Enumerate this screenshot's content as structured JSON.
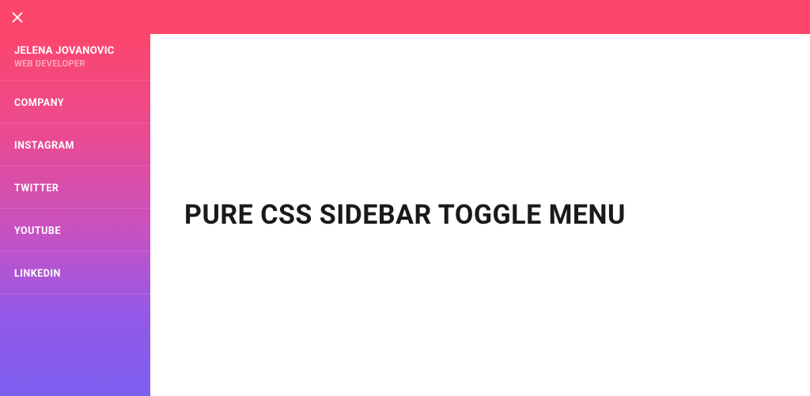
{
  "profile": {
    "name": "JELENA JOVANOVIC",
    "role": "WEB DEVELOPER"
  },
  "sidebar": {
    "items": [
      {
        "label": "COMPANY"
      },
      {
        "label": "INSTAGRAM"
      },
      {
        "label": "TWITTER"
      },
      {
        "label": "YOUTUBE"
      },
      {
        "label": "LINKEDIN"
      }
    ]
  },
  "main": {
    "title": "PURE CSS SIDEBAR TOGGLE MENU"
  }
}
